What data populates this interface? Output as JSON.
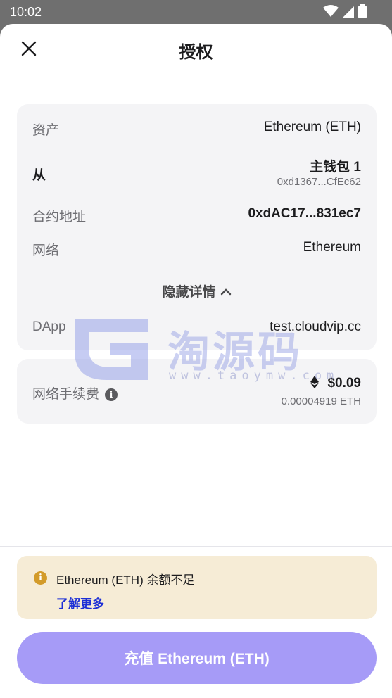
{
  "status_bar": {
    "time": "10:02"
  },
  "header": {
    "title": "授权"
  },
  "details": {
    "asset": {
      "label": "资产",
      "value": "Ethereum (ETH)"
    },
    "from": {
      "label": "从",
      "wallet": "主钱包 1",
      "address": "0xd1367...CfEc62"
    },
    "contract": {
      "label": "合约地址",
      "value": "0xdAC17...831ec7"
    },
    "network": {
      "label": "网络",
      "value": "Ethereum"
    },
    "toggle_label": "隐藏详情",
    "dapp": {
      "label": "DApp",
      "value": "test.cloudvip.cc"
    }
  },
  "fee": {
    "label": "网络手续费",
    "usd": "$0.09",
    "eth": "0.00004919 ETH"
  },
  "watermark": {
    "text": "淘源码",
    "sub": "www.taoymw.com"
  },
  "warning": {
    "text": "Ethereum (ETH) 余额不足",
    "link": "了解更多"
  },
  "cta": {
    "label": "充值 Ethereum (ETH)"
  },
  "colors": {
    "accent": "#a69bf7",
    "warning_bg": "#f6ecd6",
    "warning_icon": "#d39b2a",
    "link": "#1d2fd6"
  }
}
